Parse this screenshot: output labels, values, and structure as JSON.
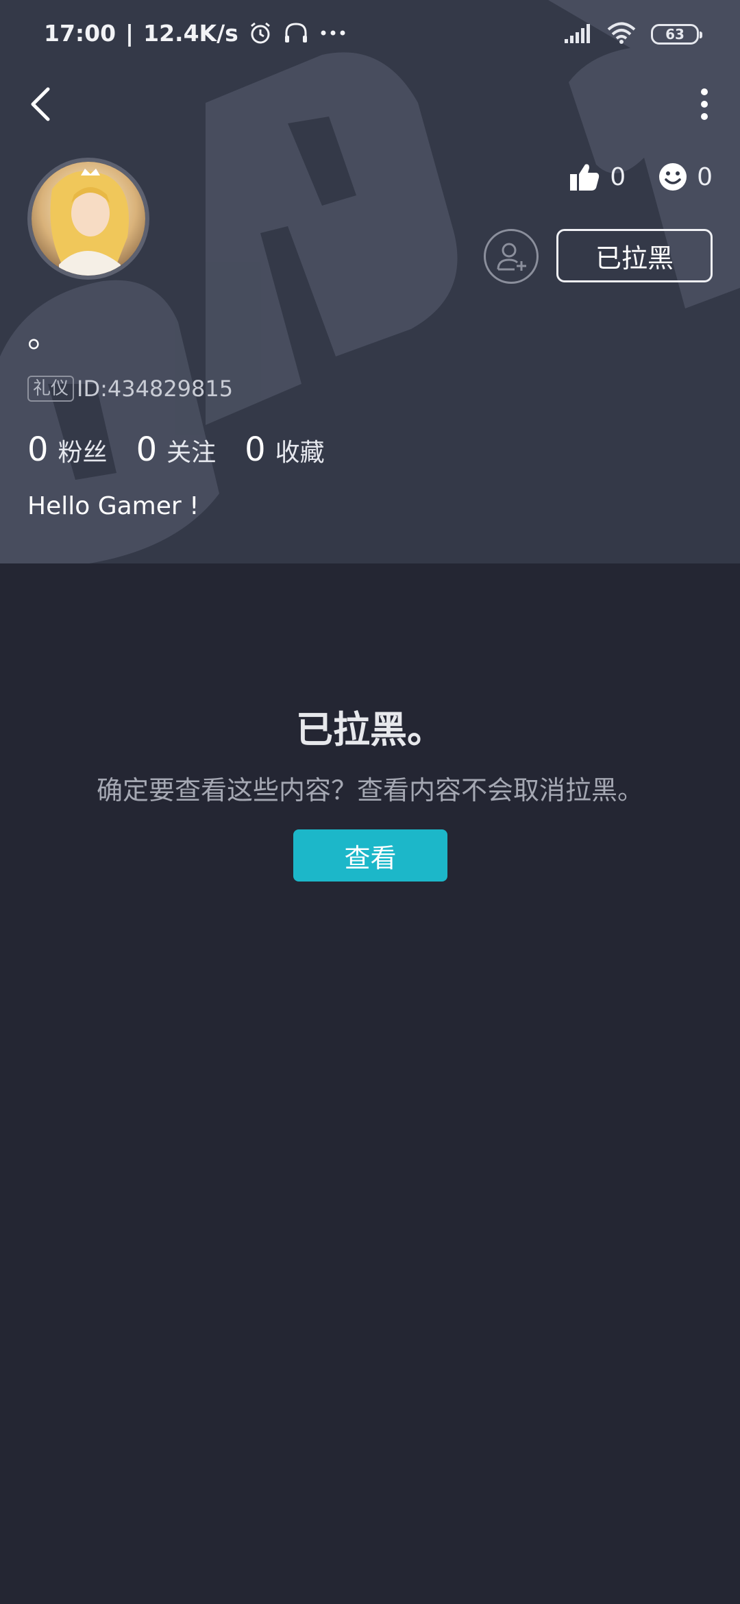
{
  "status_bar": {
    "time": "17:00",
    "net_speed": "12.4K/s",
    "battery": "63",
    "icons": [
      "alarm-icon",
      "headset-icon",
      "more-dots-icon",
      "signal-icon",
      "wifi-icon",
      "battery-icon"
    ]
  },
  "nav": {
    "back_icon": "back-arrow-icon",
    "more_icon": "more-vertical-icon"
  },
  "profile": {
    "likes_count": "0",
    "emoji_count": "0",
    "blocked_label": "已拉黑",
    "username": "。",
    "badge": "礼仪",
    "user_id": "ID:434829815",
    "stats": [
      {
        "num": "0",
        "label": "粉丝"
      },
      {
        "num": "0",
        "label": "关注"
      },
      {
        "num": "0",
        "label": "收藏"
      }
    ],
    "bio": "Hello Gamer !"
  },
  "blocked_notice": {
    "title": "已拉黑。",
    "description": "确定要查看这些内容？查看内容不会取消拉黑。",
    "view_button": "查看"
  },
  "colors": {
    "header_bg": "#343948",
    "page_bg": "#242633",
    "accent": "#1cb7c9"
  }
}
